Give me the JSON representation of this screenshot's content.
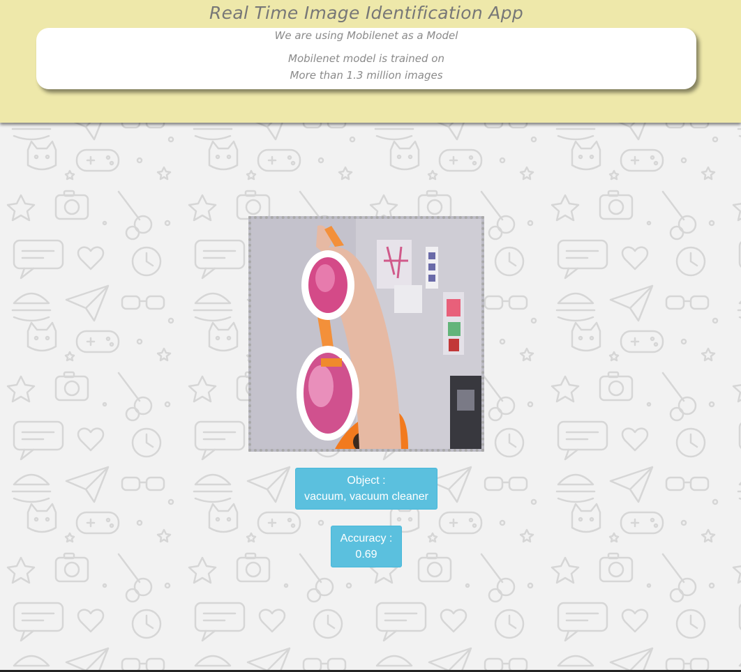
{
  "header": {
    "title": "Real Time Image Identification App",
    "model_line": "We are using Mobilenet as a Model",
    "trained_line": "Mobilenet model is trained on",
    "images_line": "More than 1.3 million images",
    "background_color": "#eee8aa"
  },
  "webcam": {
    "description_icon": "webcam-video-feed"
  },
  "result": {
    "object_label": "Object :",
    "object_value": "vacuum, vacuum cleaner",
    "accuracy_label": "Accuracy :",
    "accuracy_value": "0.69",
    "button_color": "#5bc0de"
  }
}
